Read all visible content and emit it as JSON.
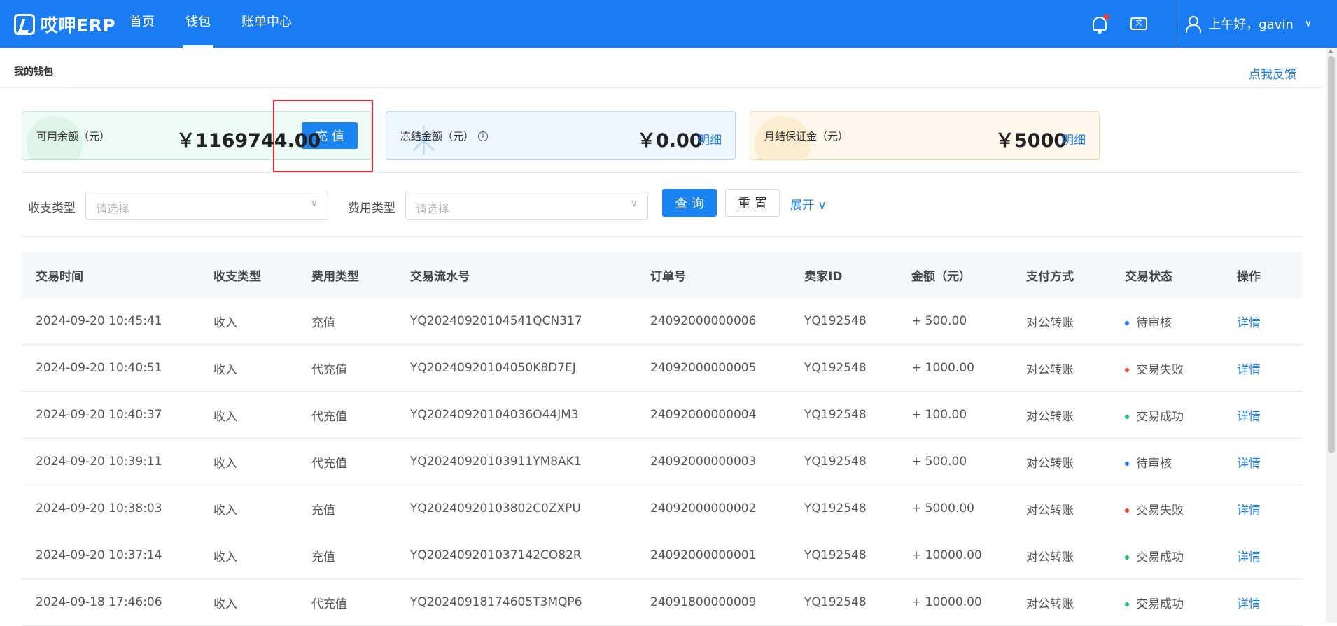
{
  "app": {
    "logo_text": "哎呷ERP"
  },
  "nav": {
    "items": [
      "首页",
      "钱包",
      "账单中心"
    ],
    "active_index": 1
  },
  "header": {
    "lang_icon_text": "文",
    "greeting": "上午好，gavin"
  },
  "tabs": {
    "active": "我的钱包",
    "feedback": "点我反馈"
  },
  "wallet": {
    "available": {
      "label": "可用余额（元）",
      "amount": "￥1169744.00",
      "action": "充 值"
    },
    "frozen": {
      "label": "冻结金额（元）",
      "amount": "￥0.00",
      "link": "明细"
    },
    "deposit": {
      "label": "月结保证金（元）",
      "amount": "￥5000",
      "link": "明细"
    }
  },
  "filters": {
    "income_type": {
      "label": "收支类型",
      "placeholder": "请选择"
    },
    "fee_type": {
      "label": "费用类型",
      "placeholder": "请选择"
    },
    "query": "查 询",
    "reset": "重 置",
    "expand": "展开"
  },
  "table": {
    "headers": [
      "交易时间",
      "收支类型",
      "费用类型",
      "交易流水号",
      "订单号",
      "卖家ID",
      "金额（元）",
      "支付方式",
      "交易状态",
      "操作"
    ],
    "rows": [
      {
        "time": "2024-09-20 10:45:41",
        "io": "收入",
        "fee": "充值",
        "serial": "YQ20240920104541QCN317",
        "order": "24092000000006",
        "seller": "YQ192548",
        "amount": "+ 500.00",
        "pay": "对公转账",
        "status": "待审核",
        "status_color": "#1a7cf3",
        "op": "详情"
      },
      {
        "time": "2024-09-20 10:40:51",
        "io": "收入",
        "fee": "代充值",
        "serial": "YQ20240920104050K8D7EJ",
        "order": "24092000000005",
        "seller": "YQ192548",
        "amount": "+ 1000.00",
        "pay": "对公转账",
        "status": "交易失败",
        "status_color": "#f5402c",
        "op": "详情"
      },
      {
        "time": "2024-09-20 10:40:37",
        "io": "收入",
        "fee": "代充值",
        "serial": "YQ20240920104036O44JM3",
        "order": "24092000000004",
        "seller": "YQ192548",
        "amount": "+ 100.00",
        "pay": "对公转账",
        "status": "交易成功",
        "status_color": "#19be6b",
        "op": "详情"
      },
      {
        "time": "2024-09-20 10:39:11",
        "io": "收入",
        "fee": "代充值",
        "serial": "YQ20240920103911YM8AK1",
        "order": "24092000000003",
        "seller": "YQ192548",
        "amount": "+ 500.00",
        "pay": "对公转账",
        "status": "待审核",
        "status_color": "#1a7cf3",
        "op": "详情"
      },
      {
        "time": "2024-09-20 10:38:03",
        "io": "收入",
        "fee": "充值",
        "serial": "YQ20240920103802C0ZXPU",
        "order": "24092000000002",
        "seller": "YQ192548",
        "amount": "+ 5000.00",
        "pay": "对公转账",
        "status": "交易失败",
        "status_color": "#f5402c",
        "op": "详情"
      },
      {
        "time": "2024-09-20 10:37:14",
        "io": "收入",
        "fee": "充值",
        "serial": "YQ202409201037142CO82R",
        "order": "24092000000001",
        "seller": "YQ192548",
        "amount": "+ 10000.00",
        "pay": "对公转账",
        "status": "交易成功",
        "status_color": "#19be6b",
        "op": "详情"
      },
      {
        "time": "2024-09-18 17:46:06",
        "io": "收入",
        "fee": "代充值",
        "serial": "YQ20240918174605T3MQP6",
        "order": "24091800000009",
        "seller": "YQ192548",
        "amount": "+ 10000.00",
        "pay": "对公转账",
        "status": "交易成功",
        "status_color": "#19be6b",
        "op": "详情"
      }
    ]
  }
}
